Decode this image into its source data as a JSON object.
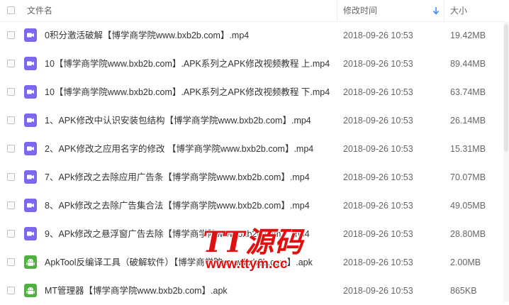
{
  "header": {
    "name_label": "文件名",
    "date_label": "修改时间",
    "size_label": "大小",
    "sort_icon": "arrow-down-icon"
  },
  "colors": {
    "video_icon": "#7b68ee",
    "apk_icon": "#52b043",
    "watermark": "#e01010"
  },
  "files": [
    {
      "name": "0积分激活破解【博学商学院www.bxb2b.com】.mp4",
      "date": "2018-09-26 10:53",
      "size": "19.42MB",
      "type": "video"
    },
    {
      "name": "10【博学商学院www.bxb2b.com】.APK系列之APK修改视频教程 上.mp4",
      "date": "2018-09-26 10:53",
      "size": "89.44MB",
      "type": "video"
    },
    {
      "name": "10【博学商学院www.bxb2b.com】.APK系列之APK修改视频教程 下.mp4",
      "date": "2018-09-26 10:53",
      "size": "63.74MB",
      "type": "video"
    },
    {
      "name": "1、APK修改中认识安装包结构【博学商学院www.bxb2b.com】.mp4",
      "date": "2018-09-26 10:53",
      "size": "26.14MB",
      "type": "video"
    },
    {
      "name": "2、APK修改之应用名字的修改 【博学商学院www.bxb2b.com】.mp4",
      "date": "2018-09-26 10:53",
      "size": "15.31MB",
      "type": "video"
    },
    {
      "name": "7、APk修改之去除应用广告条【博学商学院www.bxb2b.com】.mp4",
      "date": "2018-09-26 10:53",
      "size": "70.07MB",
      "type": "video"
    },
    {
      "name": "8、APk修改之去除广告集合法【博学商学院www.bxb2b.com】.mp4",
      "date": "2018-09-26 10:53",
      "size": "49.05MB",
      "type": "video"
    },
    {
      "name": "9、APk修改之悬浮窗广告去除【博学商学院www.bxb2b.com】.mp4",
      "date": "2018-09-26 10:53",
      "size": "28.80MB",
      "type": "video"
    },
    {
      "name": "ApkTool反编译工具（破解软件）【博学商学院www.bxb2b.com】.apk",
      "date": "2018-09-26 10:53",
      "size": "2.00MB",
      "type": "apk"
    },
    {
      "name": "MT管理器【博学商学院www.bxb2b.com】.apk",
      "date": "2018-09-26 10:53",
      "size": "865KB",
      "type": "apk"
    }
  ],
  "watermark": {
    "line1": "TT源码",
    "line2": "www.ttym.cc"
  }
}
